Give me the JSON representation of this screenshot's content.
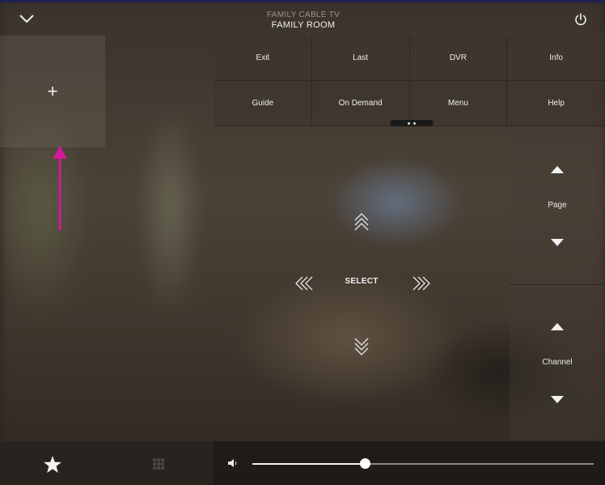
{
  "header": {
    "subtitle": "FAMILY CABLE TV",
    "title": "FAMILY ROOM"
  },
  "icons": {
    "collapse": "chevron-down-icon",
    "power": "power-icon",
    "add": "plus-icon",
    "favorites": "star-icon",
    "keypad": "keypad-grid-icon",
    "volume": "speaker-icon"
  },
  "add_panel": {
    "label": "+"
  },
  "buttons": [
    {
      "label": "Exit"
    },
    {
      "label": "Last"
    },
    {
      "label": "DVR"
    },
    {
      "label": "Info"
    },
    {
      "label": "Guide"
    },
    {
      "label": "On Demand"
    },
    {
      "label": "Menu"
    },
    {
      "label": "Help"
    }
  ],
  "dpad": {
    "select_label": "SELECT"
  },
  "rockers": {
    "page_label": "Page",
    "channel_label": "Channel"
  },
  "volume": {
    "level": 0.33
  },
  "colors": {
    "annotation_arrow": "#d0199a",
    "top_stripe": "#1d2250"
  }
}
